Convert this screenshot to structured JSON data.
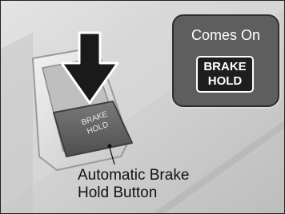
{
  "indicator": {
    "title": "Comes On",
    "icon_line1": "BRAKE",
    "icon_line2": "HOLD"
  },
  "button": {
    "label_line1": "BRAKE",
    "label_line2": "HOLD"
  },
  "caption": {
    "line1": "Automatic Brake",
    "line2": "Hold Button"
  },
  "colors": {
    "indicator_bg": "#5e5e5e",
    "icon_bg": "#1e1e1e",
    "arrow": "#1a1a1a",
    "button_face": "#6a6a6a"
  }
}
